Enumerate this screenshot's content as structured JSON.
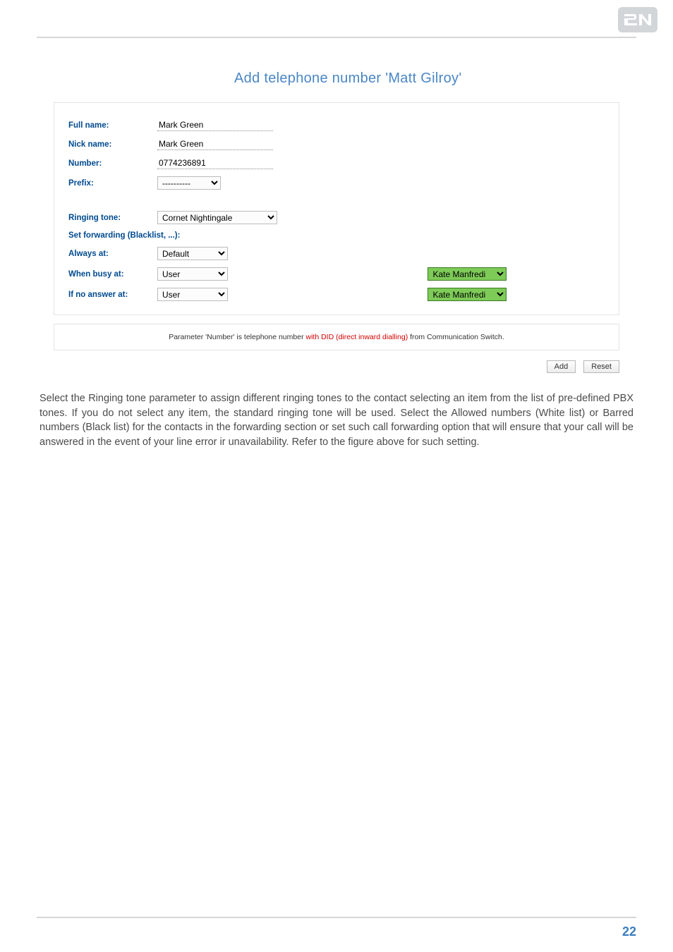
{
  "title": "Add telephone number 'Matt Gilroy'",
  "form": {
    "fullname": {
      "label": "Full name:",
      "value": "Mark Green"
    },
    "nickname": {
      "label": "Nick name:",
      "value": "Mark Green"
    },
    "number": {
      "label": "Number:",
      "value": "0774236891"
    },
    "prefix": {
      "label": "Prefix:",
      "value": "----------"
    },
    "ringtone": {
      "label": "Ringing tone:",
      "value": "Cornet Nightingale"
    },
    "forwarding_heading": "Set forwarding (Blacklist, ...):",
    "always": {
      "label": "Always at:",
      "value": "Default",
      "user": ""
    },
    "busy": {
      "label": "When busy at:",
      "value": "User",
      "user": "Kate Manfredi"
    },
    "noanswer": {
      "label": "If no answer at:",
      "value": "User",
      "user": "Kate Manfredi"
    }
  },
  "info": {
    "pre": "Parameter 'Number' is telephone number ",
    "red": "with DID (direct inward dialling)",
    "post": " from Communication Switch."
  },
  "buttons": {
    "add": "Add",
    "reset": "Reset"
  },
  "paragraph": "Select the Ringing tone parameter to assign different ringing tones to the contact selecting an item from the list of pre-defined PBX tones. If you do not select any item, the standard ringing tone will be used. Select the Allowed numbers (White list) or Barred numbers (Black list) for the contacts in the forwarding section or set such call forwarding option that will ensure that your call will be answered in the event of your line error ir unavailability. Refer to the figure above for such setting.",
  "page_number": "22"
}
